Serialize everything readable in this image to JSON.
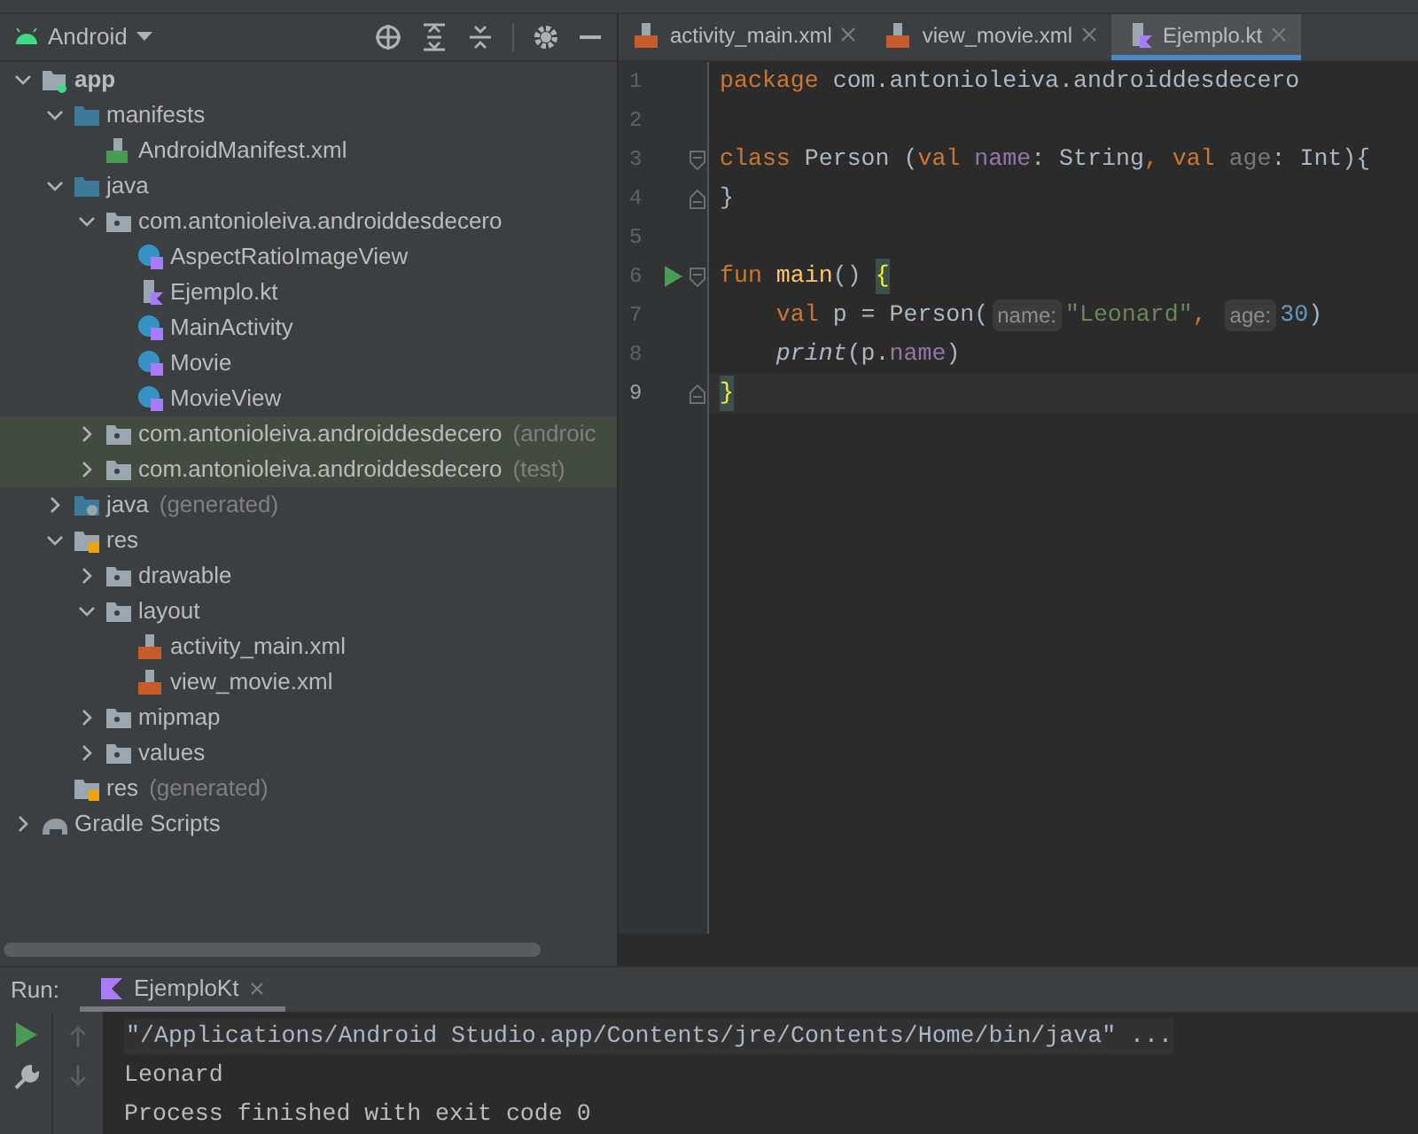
{
  "project_panel": {
    "view_selector": "Android",
    "tree": [
      {
        "label": "app",
        "kind": "module",
        "expanded": true,
        "selected": false,
        "children": [
          {
            "label": "manifests",
            "kind": "folder",
            "expanded": true,
            "selected": false,
            "children": [
              {
                "label": "AndroidManifest.xml",
                "kind": "manifest",
                "selected": false
              }
            ]
          },
          {
            "label": "java",
            "kind": "folder",
            "expanded": true,
            "selected": false,
            "children": [
              {
                "label": "com.antonioleiva.androiddesdecero",
                "kind": "package",
                "expanded": true,
                "selected": false,
                "children": [
                  {
                    "label": "AspectRatioImageView",
                    "kind": "kotlin-class",
                    "selected": false
                  },
                  {
                    "label": "Ejemplo.kt",
                    "kind": "kotlin-file",
                    "selected": false
                  },
                  {
                    "label": "MainActivity",
                    "kind": "kotlin-class",
                    "selected": false
                  },
                  {
                    "label": "Movie",
                    "kind": "kotlin-class",
                    "selected": false
                  },
                  {
                    "label": "MovieView",
                    "kind": "kotlin-class",
                    "selected": false
                  }
                ]
              },
              {
                "label": "com.antonioleiva.androiddesdecero",
                "suffix": "(androic",
                "kind": "package",
                "expanded": false,
                "selected": true
              },
              {
                "label": "com.antonioleiva.androiddesdecero",
                "suffix": "(test)",
                "kind": "package",
                "expanded": false,
                "selected": true
              }
            ]
          },
          {
            "label": "java",
            "suffix": "(generated)",
            "kind": "generated-folder",
            "expanded": false,
            "selected": false
          },
          {
            "label": "res",
            "kind": "res-folder",
            "expanded": true,
            "selected": false,
            "children": [
              {
                "label": "drawable",
                "kind": "package",
                "expanded": false,
                "selected": false
              },
              {
                "label": "layout",
                "kind": "package",
                "expanded": true,
                "selected": false,
                "children": [
                  {
                    "label": "activity_main.xml",
                    "kind": "xml",
                    "selected": false
                  },
                  {
                    "label": "view_movie.xml",
                    "kind": "xml",
                    "selected": false
                  }
                ]
              },
              {
                "label": "mipmap",
                "kind": "package",
                "expanded": false,
                "selected": false
              },
              {
                "label": "values",
                "kind": "package",
                "expanded": false,
                "selected": false
              }
            ]
          },
          {
            "label": "res",
            "suffix": "(generated)",
            "kind": "res-folder",
            "selected": false
          }
        ]
      },
      {
        "label": "Gradle Scripts",
        "kind": "gradle",
        "expanded": false,
        "selected": false
      }
    ]
  },
  "editor": {
    "tabs": [
      {
        "label": "activity_main.xml",
        "kind": "xml",
        "selected": false
      },
      {
        "label": "view_movie.xml",
        "kind": "xml",
        "selected": false
      },
      {
        "label": "Ejemplo.kt",
        "kind": "kotlin-file",
        "selected": true
      }
    ],
    "lines": [
      {
        "number": "1",
        "current": false,
        "run": false,
        "kind": "plain",
        "tokens": [
          {
            "kind": "keyword",
            "text": "package"
          },
          {
            "kind": "plain",
            "text": " com.antonioleiva.androiddesdecero"
          }
        ]
      },
      {
        "number": "2",
        "current": false,
        "run": false,
        "kind": "plain"
      },
      {
        "number": "3",
        "current": false,
        "run": false,
        "kind": "fold-start",
        "tokens": [
          {
            "kind": "keyword",
            "text": "class"
          },
          {
            "kind": "plain",
            "text": " Person ("
          },
          {
            "kind": "keyword",
            "text": "val"
          },
          {
            "kind": "property",
            "text": " name"
          },
          {
            "kind": "plain",
            "text": ": String"
          },
          {
            "kind": "keyword",
            "text": ", val"
          },
          {
            "kind": "unused",
            "text": " age"
          },
          {
            "kind": "plain",
            "text": ": Int){"
          }
        ]
      },
      {
        "number": "4",
        "current": false,
        "run": false,
        "kind": "fold-end",
        "tokens": [
          {
            "kind": "plain",
            "text": "}"
          }
        ]
      },
      {
        "number": "5",
        "current": false,
        "run": false,
        "kind": "plain"
      },
      {
        "number": "6",
        "current": false,
        "run": true,
        "kind": "fold-start",
        "tokens": [
          {
            "kind": "keyword",
            "text": "fun"
          },
          {
            "kind": "function",
            "text": " main"
          },
          {
            "kind": "plain",
            "text": "() "
          },
          {
            "kind": "brace",
            "text": "{"
          }
        ]
      },
      {
        "number": "7",
        "current": false,
        "run": false,
        "kind": "plain",
        "tokens": [
          {
            "kind": "keyword",
            "text": "    val"
          },
          {
            "kind": "plain",
            "text": " p = Person("
          },
          {
            "kind": "hint",
            "text": "name:"
          },
          {
            "kind": "string",
            "text": "\"Leonard\""
          },
          {
            "kind": "keyword",
            "text": ", "
          },
          {
            "kind": "hint",
            "text": "age:"
          },
          {
            "kind": "number",
            "text": "30"
          },
          {
            "kind": "plain",
            "text": ")"
          }
        ]
      },
      {
        "number": "8",
        "current": false,
        "run": false,
        "kind": "plain",
        "tokens": [
          {
            "kind": "call",
            "text": "    print"
          },
          {
            "kind": "plain",
            "text": "(p."
          },
          {
            "kind": "property",
            "text": "name"
          },
          {
            "kind": "plain",
            "text": ")"
          }
        ]
      },
      {
        "number": "9",
        "current": true,
        "run": false,
        "kind": "fold-end",
        "tokens": [
          {
            "kind": "brace",
            "text": "}"
          }
        ]
      }
    ]
  },
  "run_panel": {
    "label": "Run:",
    "tabs": [
      {
        "label": "EjemploKt",
        "selected": true
      }
    ],
    "output": [
      {
        "kind": "command",
        "text": "\"/Applications/Android Studio.app/Contents/jre/Contents/Home/bin/java\" ..."
      },
      {
        "kind": "plain",
        "text": "Leonard"
      },
      {
        "kind": "plain",
        "text": "Process finished with exit code 0"
      }
    ]
  }
}
